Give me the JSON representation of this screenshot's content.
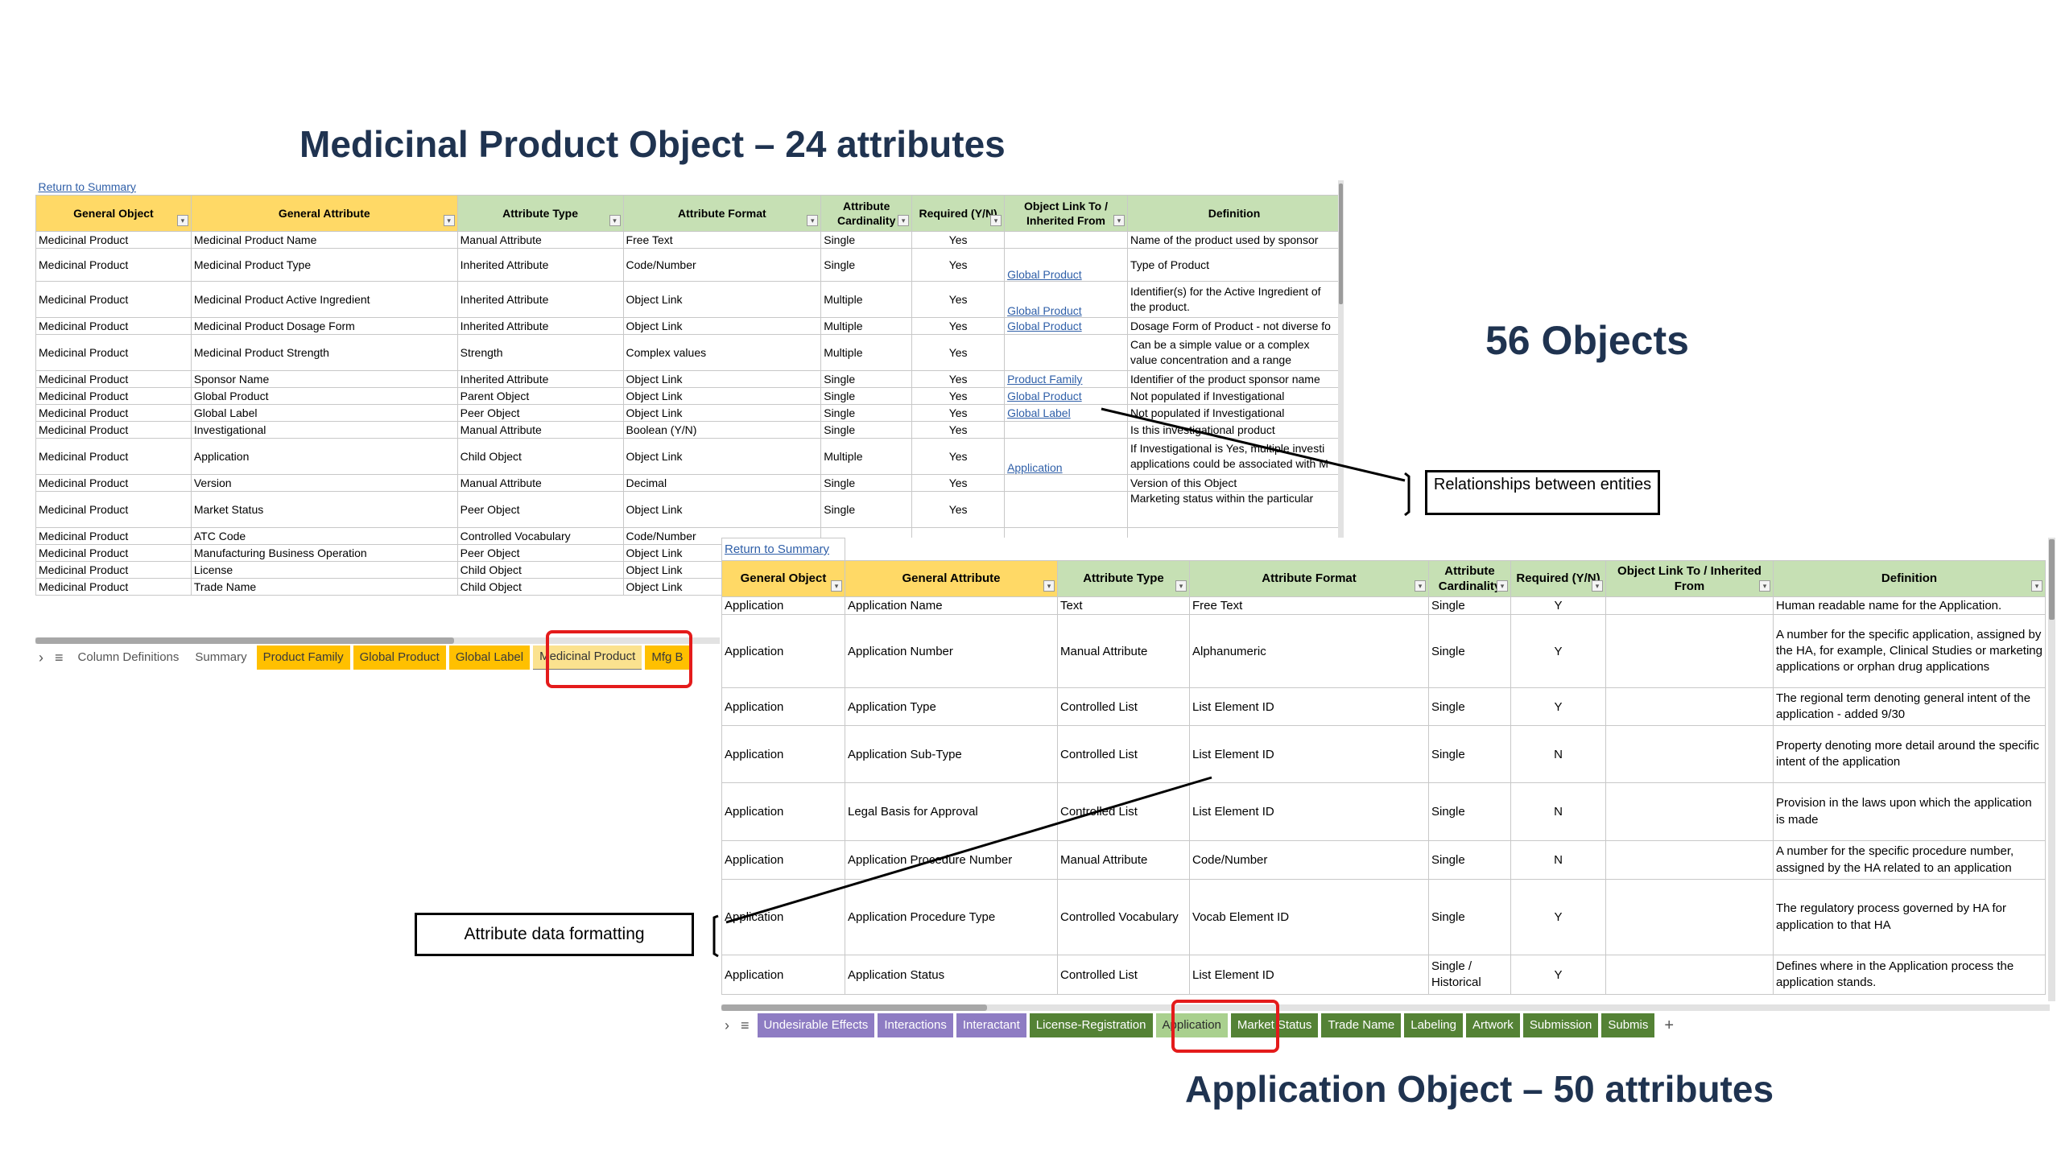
{
  "titles": {
    "medicinal": "Medicinal Product Object – 24 attributes",
    "objects": "56 Objects",
    "application": "Application Object – 50 attributes"
  },
  "callouts": {
    "relationships": "Relationships between entities",
    "formatting": "Attribute data formatting"
  },
  "sheet1": {
    "return_link": "Return to Summary",
    "headers": [
      "General Object",
      "General Attribute",
      "Attribute Type",
      "Attribute Format",
      "Attribute Cardinality",
      "Required (Y/N)",
      "Object Link To / Inherited From",
      "Definition"
    ],
    "rows": [
      [
        "Medicinal Product",
        "Medicinal Product Name",
        "Manual Attribute",
        "Free Text",
        "Single",
        "Yes",
        "",
        "Name of the product used by sponsor"
      ],
      [
        "Medicinal Product",
        "Medicinal Product Type",
        "Inherited Attribute",
        "Code/Number",
        "Single",
        "Yes",
        "Global Product",
        "Type of Product"
      ],
      [
        "Medicinal Product",
        "Medicinal Product Active Ingredient",
        "Inherited Attribute",
        "Object Link",
        "Multiple",
        "Yes",
        "Global Product",
        "Identifier(s) for the Active Ingredient of the product."
      ],
      [
        "Medicinal Product",
        "Medicinal Product Dosage Form",
        "Inherited Attribute",
        "Object Link",
        "Multiple",
        "Yes",
        "Global Product",
        "Dosage Form of Product - not diverse fo"
      ],
      [
        "Medicinal Product",
        "Medicinal Product Strength",
        "Strength",
        "Complex values",
        "Multiple",
        "Yes",
        "",
        "Can be a simple value or a complex value concentration and a range"
      ],
      [
        "Medicinal Product",
        "Sponsor Name",
        "Inherited Attribute",
        "Object Link",
        "Single",
        "Yes",
        "Product Family",
        "Identifier of the product sponsor name"
      ],
      [
        "Medicinal Product",
        "Global Product",
        "Parent Object",
        "Object Link",
        "Single",
        "Yes",
        "Global Product",
        "Not populated if Investigational"
      ],
      [
        "Medicinal Product",
        "Global Label",
        "Peer Object",
        "Object Link",
        "Single",
        "Yes",
        "Global Label",
        "Not populated if Investigational"
      ],
      [
        "Medicinal Product",
        "Investigational",
        "Manual Attribute",
        "Boolean (Y/N)",
        "Single",
        "Yes",
        "",
        "Is this investigational product"
      ],
      [
        "Medicinal Product",
        "Application",
        "Child Object",
        "Object Link",
        "Multiple",
        "Yes",
        "Application",
        "If Investigational is Yes, multiple investi applications could be associated with M"
      ],
      [
        "Medicinal Product",
        "Version",
        "Manual Attribute",
        "Decimal",
        "Single",
        "Yes",
        "",
        "Version of this Object"
      ],
      [
        "Medicinal Product",
        "Market Status",
        "Peer Object",
        "Object Link",
        "Single",
        "Yes",
        "",
        "Marketing status within the particular"
      ],
      [
        "Medicinal Product",
        "ATC Code",
        "Controlled Vocabulary",
        "Code/Number",
        "",
        "",
        "",
        ""
      ],
      [
        "Medicinal Product",
        "Manufacturing Business Operation",
        "Peer Object",
        "Object Link",
        "",
        "",
        "",
        ""
      ],
      [
        "Medicinal Product",
        "License",
        "Child Object",
        "Object Link",
        "",
        "",
        "",
        ""
      ],
      [
        "Medicinal Product",
        "Trade Name",
        "Child Object",
        "Object Link",
        "",
        "",
        "",
        ""
      ]
    ],
    "tabs": [
      "Column Definitions",
      "Summary",
      "Product Family",
      "Global Product",
      "Global Label",
      "Medicinal Product",
      "Mfg B"
    ],
    "active_tab": "Medicinal Product"
  },
  "sheet2": {
    "return_link": "Return to Summary",
    "headers": [
      "General Object",
      "General Attribute",
      "Attribute Type",
      "Attribute Format",
      "Attribute Cardinality",
      "Required (Y/N)",
      "Object Link To / Inherited From",
      "Definition"
    ],
    "rows": [
      [
        "Application",
        "Application  Name",
        "Text",
        "Free Text",
        "Single",
        "Y",
        "",
        "Human readable name for the Application."
      ],
      [
        "Application",
        "Application Number",
        "Manual Attribute",
        "Alphanumeric",
        "Single",
        "Y",
        "",
        "A number for the specific application, assigned by the HA, for example, Clinical Studies or marketing applications or orphan drug applications"
      ],
      [
        "Application",
        "Application Type",
        "Controlled List",
        "List Element ID",
        "Single",
        "Y",
        "",
        "The regional term denoting general intent of the application - added 9/30"
      ],
      [
        "Application",
        "Application Sub-Type",
        "Controlled List",
        "List Element ID",
        "Single",
        "N",
        "",
        "Property denoting more detail around the specific intent of the application"
      ],
      [
        "Application",
        "Legal Basis for Approval",
        "Controlled List",
        "List Element ID",
        "Single",
        "N",
        "",
        "Provision in the laws upon which the application is made"
      ],
      [
        "Application",
        "Application Procedure Number",
        "Manual Attribute",
        "Code/Number",
        "Single",
        "N",
        "",
        "A number for the specific procedure number, assigned by the HA related to an application"
      ],
      [
        "Application",
        "Application Procedure Type",
        "Controlled Vocabulary",
        "Vocab Element ID",
        "Single",
        "Y",
        "",
        "The regulatory process governed by HA for application to that HA"
      ],
      [
        "Application",
        "Application Status",
        "Controlled List",
        "List Element ID",
        "Single / Historical",
        "Y",
        "",
        "Defines where in the Application process the application stands."
      ]
    ],
    "tabs_purple": [
      "Undesirable Effects",
      "Interactions",
      "Interactant"
    ],
    "tabs_green": [
      "License-Registration",
      "Application",
      "Market Status",
      "Trade Name",
      "Labeling",
      "Artwork",
      "Submission",
      "Submis"
    ],
    "active_tab": "Application"
  },
  "colors": {
    "title": "#1f3350",
    "header_yellow": "#ffd966",
    "header_green": "#c6e0b4",
    "tab_orange": "#ffc000",
    "tab_purple": "#8e7cc3",
    "tab_green": "#548235",
    "highlight_red": "#e41b1b",
    "link_blue": "#2f5fa8"
  }
}
